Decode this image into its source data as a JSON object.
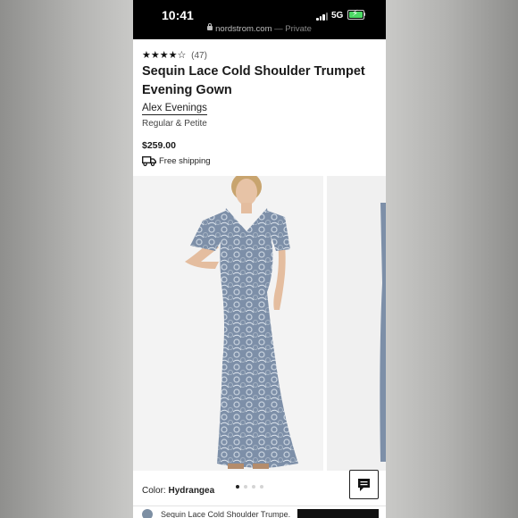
{
  "status_bar": {
    "time": "10:41",
    "network": "5G"
  },
  "browser": {
    "domain": "nordstrom.com",
    "private_label": "— Private"
  },
  "product": {
    "rating_stars": 4,
    "rating_max": 5,
    "review_count": "(47)",
    "title": "Sequin Lace Cold Shoulder Trumpet Evening Gown",
    "brand": "Alex Evenings",
    "sizes": "Regular & Petite",
    "price": "$259.00",
    "shipping": "Free shipping",
    "color_label": "Color:",
    "color_value": "Hydrangea"
  },
  "gallery": {
    "total_images": 4,
    "active_index": 0,
    "dress_color": "#7d8fa8"
  },
  "sticky_bar": {
    "title": "Sequin Lace Cold Shoulder Trumpe..."
  },
  "colors": {
    "accent": "#000000",
    "rating": "#111111"
  }
}
